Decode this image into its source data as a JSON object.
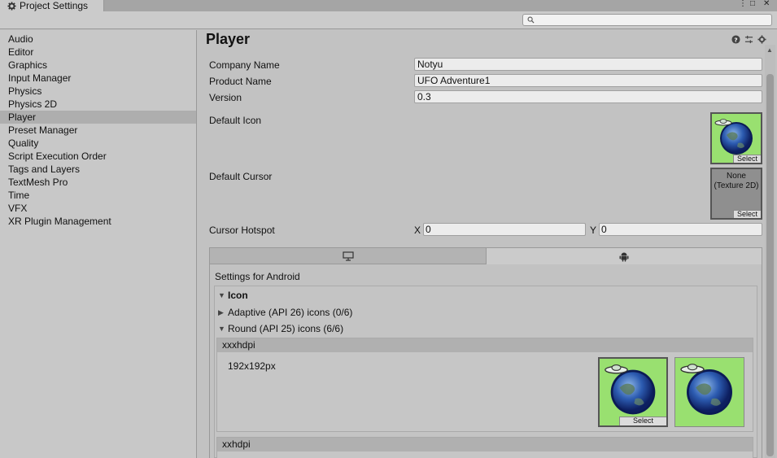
{
  "window": {
    "tab_title": "Project Settings",
    "controls": [
      "⋮",
      "□",
      "✕"
    ]
  },
  "search": {
    "value": "",
    "placeholder": ""
  },
  "sidebar": {
    "items": [
      {
        "label": "Audio",
        "active": false
      },
      {
        "label": "Editor",
        "active": false
      },
      {
        "label": "Graphics",
        "active": false
      },
      {
        "label": "Input Manager",
        "active": false
      },
      {
        "label": "Physics",
        "active": false
      },
      {
        "label": "Physics 2D",
        "active": false
      },
      {
        "label": "Player",
        "active": true
      },
      {
        "label": "Preset Manager",
        "active": false
      },
      {
        "label": "Quality",
        "active": false
      },
      {
        "label": "Script Execution Order",
        "active": false
      },
      {
        "label": "Tags and Layers",
        "active": false
      },
      {
        "label": "TextMesh Pro",
        "active": false
      },
      {
        "label": "Time",
        "active": false
      },
      {
        "label": "VFX",
        "active": false
      },
      {
        "label": "XR Plugin Management",
        "active": false
      }
    ]
  },
  "player": {
    "title": "Player",
    "company_name_label": "Company Name",
    "company_name": "Notyu",
    "product_name_label": "Product Name",
    "product_name": "UFO Adventure1",
    "version_label": "Version",
    "version": "0.3",
    "default_icon_label": "Default Icon",
    "default_cursor_label": "Default Cursor",
    "cursor_none_line1": "None",
    "cursor_none_line2": "(Texture 2D)",
    "select_label": "Select",
    "cursor_hotspot_label": "Cursor Hotspot",
    "hotspot_x_label": "X",
    "hotspot_x": "0",
    "hotspot_y_label": "Y",
    "hotspot_y": "0"
  },
  "platform": {
    "settings_title": "Settings for Android",
    "icon_section": "Icon",
    "adaptive_label": "Adaptive (API 26) icons (0/6)",
    "round_label": "Round (API 25) icons (6/6)",
    "xxxhdpi_label": "xxxhdpi",
    "xxxhdpi_size": "192x192px",
    "xxhdpi_label": "xxhdpi"
  },
  "colors": {
    "icon_bg": "#99e070",
    "selected_sidebar": "#aeaeae",
    "panel_bg": "#c2c2c2"
  },
  "icons": {
    "settings": "gear-icon",
    "help": "help-icon",
    "presets": "sliders-icon",
    "menu": "gear-icon",
    "desktop_tab": "monitor-icon",
    "android_tab": "android-icon"
  }
}
